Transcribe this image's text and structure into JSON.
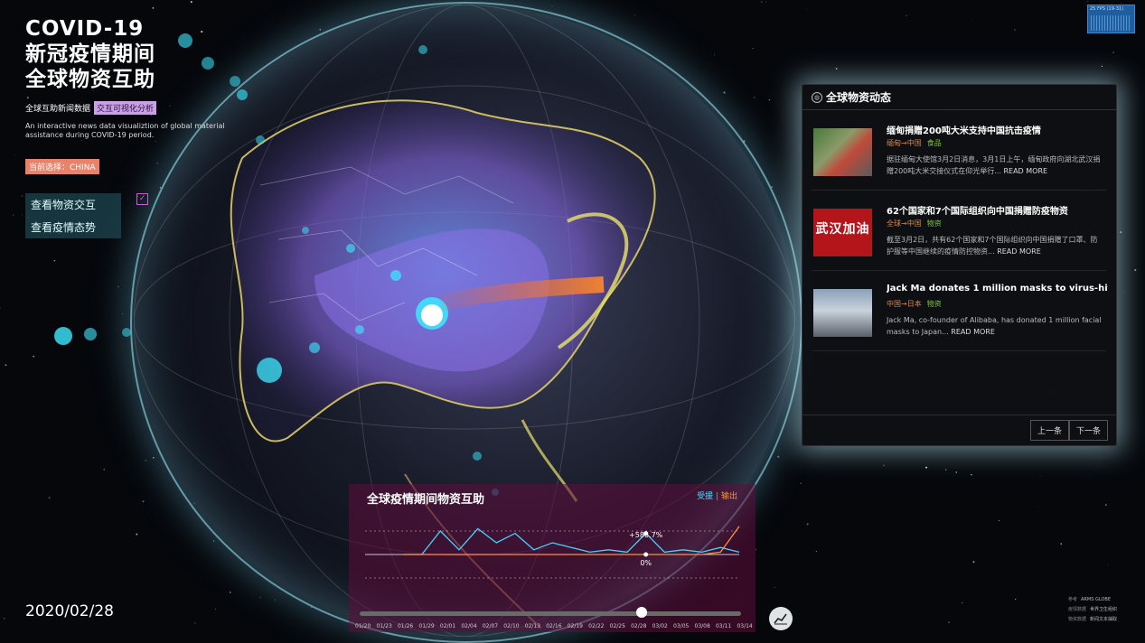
{
  "title": {
    "line1": "COVID-19",
    "line2": "新冠疫情期间",
    "line3": "全球物资互助"
  },
  "subtitle": {
    "left": "全球互助新闻数据",
    "tag": "交互可视化分析"
  },
  "description": "An interactive news data visualiztion of global material assistance during COVID-19 period.",
  "current_selection": "当前选择：CHINA",
  "views": {
    "materials": "查看物资交互",
    "epidemic": "查看疫情态势",
    "check": "✓"
  },
  "fps": "25 FPS (19-31)",
  "news_panel": {
    "title": "全球物资动态",
    "items": [
      {
        "title": "缅甸捐赠200吨大米支持中国抗击疫情",
        "route": "缅甸→中国",
        "category": "食品",
        "text": "据驻缅甸大使馆3月2日消息，3月1日上午，缅甸政府向湖北武汉捐赠200吨大米交接仪式在仰光举行...",
        "more": "READ MORE",
        "thumb_text": ""
      },
      {
        "title": "62个国家和7个国际组织向中国捐赠防疫物资",
        "route": "全球→中国",
        "category": "物资",
        "text": "截至3月2日，共有62个国家和7个国际组织向中国捐赠了口罩、防护服等中国继续的疫情防控物资...",
        "more": "READ MORE",
        "thumb_text": "武汉加油"
      },
      {
        "title": "Jack Ma donates 1 million masks to virus-hit Japan",
        "route": "中国→日本",
        "category": "物资",
        "text": "Jack Ma, co-founder of Alibaba, has donated 1 million facial masks to Japan...",
        "more": "READ MORE",
        "thumb_text": ""
      }
    ],
    "prev": "上一条",
    "next": "下一条"
  },
  "chart_panel": {
    "title": "全球疫情期间物资互助",
    "legend_in": "受援",
    "legend_sep": "|",
    "legend_out": "输出",
    "annotation_high": "+586.7%",
    "annotation_zero": "0%"
  },
  "chart_data": {
    "type": "line",
    "x": [
      "01/20",
      "01/23",
      "01/26",
      "01/29",
      "02/01",
      "02/04",
      "02/07",
      "02/10",
      "02/13",
      "02/16",
      "02/19",
      "02/22",
      "02/25",
      "02/28",
      "03/02",
      "03/05",
      "03/08",
      "03/11",
      "03/14"
    ],
    "series": [
      {
        "name": "受援",
        "color": "#45d3ff",
        "values": [
          0,
          0,
          1.0,
          0.2,
          1.1,
          0.5,
          0.9,
          0.2,
          0.5,
          0.3,
          0.1,
          0.2,
          0.1,
          0.9,
          0.1,
          0.2,
          0.1,
          0.3,
          0.1
        ]
      },
      {
        "name": "输出",
        "color": "#ff8f3e",
        "values": [
          0,
          0,
          0,
          0,
          0,
          0,
          0,
          0,
          0,
          0,
          0,
          0,
          0,
          0,
          0,
          0,
          0,
          0.1,
          1.2
        ]
      }
    ],
    "current_index": 13
  },
  "timeline": {
    "date": "2020/02/28",
    "position": 0.74
  },
  "credits": [
    {
      "k": "参考",
      "v": "ARMS GLOBE"
    },
    {
      "k": "疫情数据",
      "v": "世界卫生组织"
    },
    {
      "k": "物资数据",
      "v": "新闻文本抽取"
    }
  ],
  "icons": {
    "chart_toggle": "line-chart-icon",
    "news_title": "globe-icon"
  }
}
